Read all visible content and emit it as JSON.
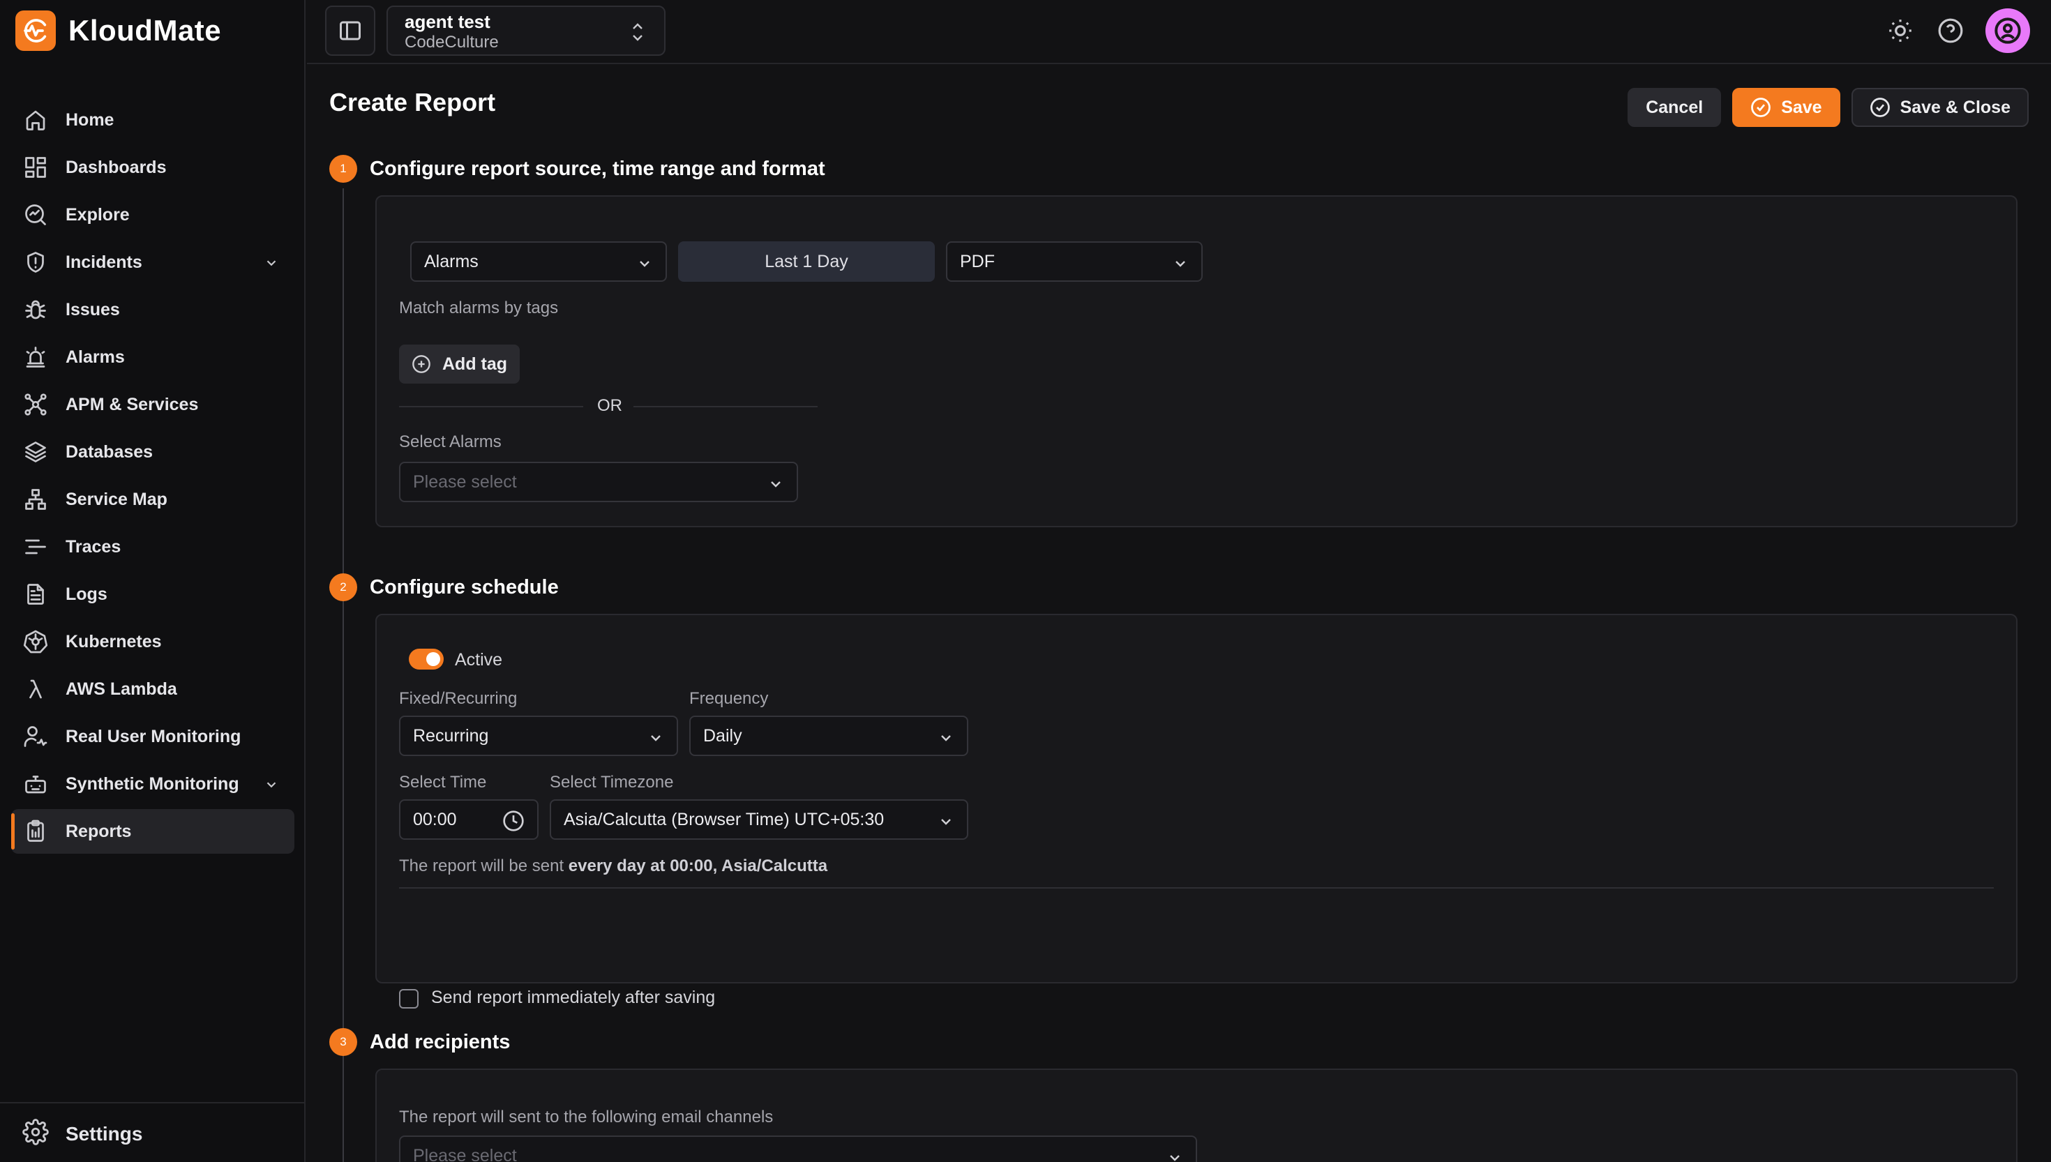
{
  "brand": {
    "name": "KloudMate"
  },
  "sidebar": {
    "items": [
      {
        "label": "Home",
        "icon": "home-icon"
      },
      {
        "label": "Dashboards",
        "icon": "dashboard-grid-icon"
      },
      {
        "label": "Explore",
        "icon": "explore-icon"
      },
      {
        "label": "Incidents",
        "icon": "shield-alert-icon",
        "expandable": true
      },
      {
        "label": "Issues",
        "icon": "bug-icon"
      },
      {
        "label": "Alarms",
        "icon": "siren-icon"
      },
      {
        "label": "APM & Services",
        "icon": "network-icon"
      },
      {
        "label": "Databases",
        "icon": "layers-icon"
      },
      {
        "label": "Service Map",
        "icon": "sitemap-icon"
      },
      {
        "label": "Traces",
        "icon": "traces-icon"
      },
      {
        "label": "Logs",
        "icon": "file-text-icon"
      },
      {
        "label": "Kubernetes",
        "icon": "kubernetes-icon"
      },
      {
        "label": "AWS Lambda",
        "icon": "lambda-icon"
      },
      {
        "label": "Real User Monitoring",
        "icon": "user-monitor-icon"
      },
      {
        "label": "Synthetic Monitoring",
        "icon": "robot-icon",
        "expandable": true
      },
      {
        "label": "Reports",
        "icon": "clipboard-icon",
        "active": true
      }
    ],
    "settings_label": "Settings"
  },
  "topbar": {
    "project_name": "agent test",
    "org_name": "CodeCulture"
  },
  "page": {
    "title": "Create Report",
    "cancel_label": "Cancel",
    "save_label": "Save",
    "save_close_label": "Save & Close"
  },
  "step1": {
    "number": "1",
    "title": "Configure report source, time range and format",
    "source_value": "Alarms",
    "time_range_value": "Last 1 Day",
    "format_value": "PDF",
    "match_tags_label": "Match alarms by tags",
    "add_tag_label": "Add tag",
    "or_label": "OR",
    "select_alarms_label": "Select Alarms",
    "select_alarms_placeholder": "Please select"
  },
  "step2": {
    "number": "2",
    "title": "Configure schedule",
    "active_label": "Active",
    "active": true,
    "fixed_recurring_label": "Fixed/Recurring",
    "fixed_recurring_value": "Recurring",
    "frequency_label": "Frequency",
    "frequency_value": "Daily",
    "select_time_label": "Select Time",
    "time_value": "00:00",
    "select_timezone_label": "Select Timezone",
    "timezone_value": "Asia/Calcutta (Browser Time) UTC+05:30",
    "summary_prefix": "The report will be sent ",
    "summary_bold": "every day at 00:00, Asia/Calcutta",
    "send_immediately_label": "Send report immediately after saving"
  },
  "step3": {
    "number": "3",
    "title": "Add recipients",
    "channels_label": "The report will sent to the following email channels",
    "channels_placeholder": "Please select"
  },
  "colors": {
    "accent": "#f47a1f",
    "background": "#121214",
    "sidebar": "#0f0f11",
    "avatar": "#e879f9"
  }
}
